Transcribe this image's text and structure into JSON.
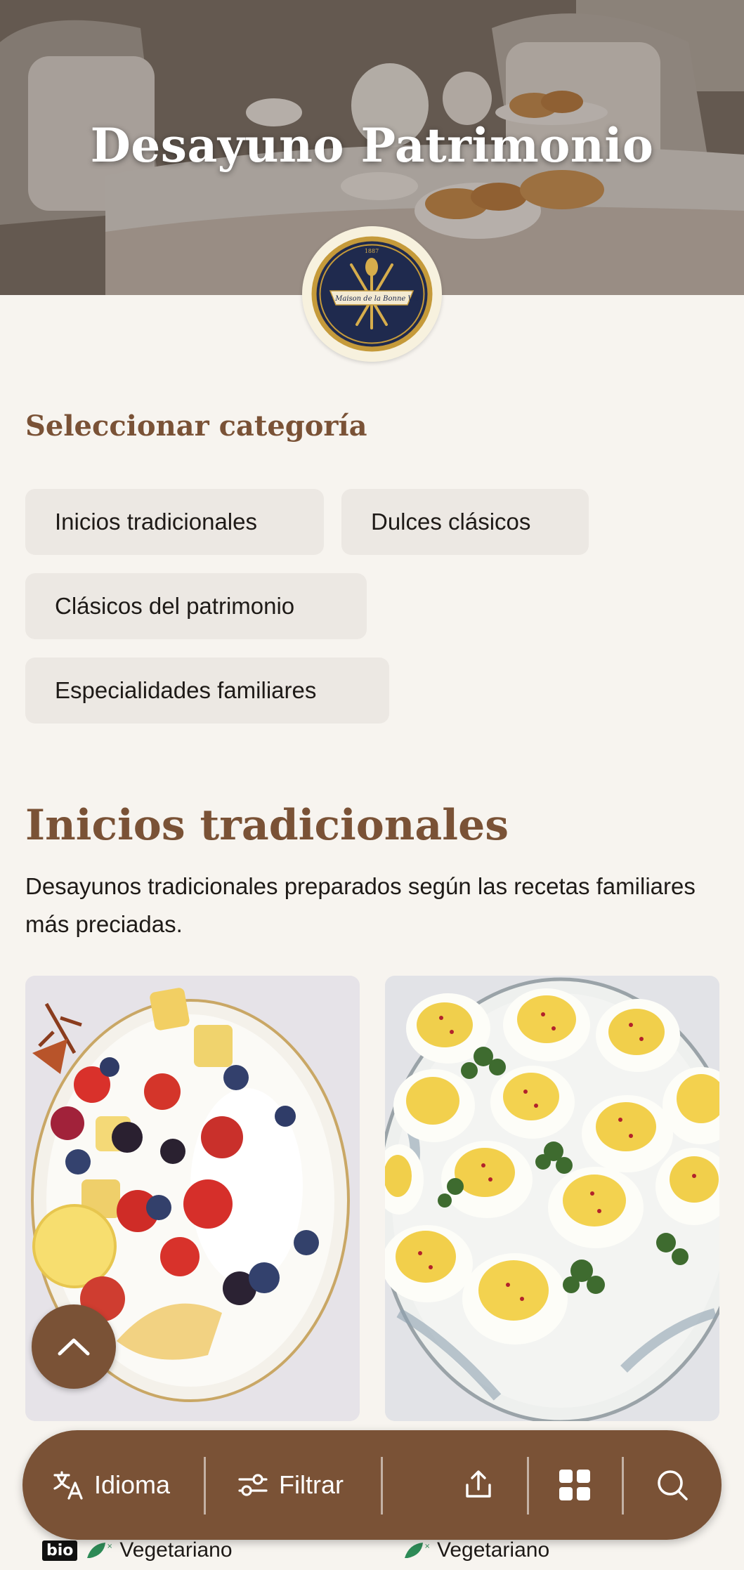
{
  "hero": {
    "title": "Desayuno Patrimonio",
    "logo": {
      "text": "La Maison de la Bonne Vie",
      "year": "1887"
    }
  },
  "categories": {
    "heading": "Seleccionar categoría",
    "chips": [
      "Inicios tradicionales",
      "Dulces clásicos",
      "Clásicos del patrimonio",
      "Especialidades familiares"
    ]
  },
  "section": {
    "title": "Inicios tradicionales",
    "description": "Desayunos tradicionales preparados según las recetas familiares más preciadas."
  },
  "cards": [
    {
      "image": "fruit-yogurt-platter",
      "tags": [
        "bio",
        "Vegetariano"
      ]
    },
    {
      "image": "deviled-eggs-platter",
      "tags": [
        "Vegetariano"
      ]
    }
  ],
  "toolbar": {
    "language_label": "Idioma",
    "filter_label": "Filtrar",
    "icons": [
      "translate-icon",
      "filter-icon",
      "share-icon",
      "grid-icon",
      "search-icon"
    ]
  },
  "colors": {
    "accent": "#7a5236",
    "background": "#f7f4ef",
    "chip": "#ece8e3",
    "tag_green": "#2e8b57"
  }
}
